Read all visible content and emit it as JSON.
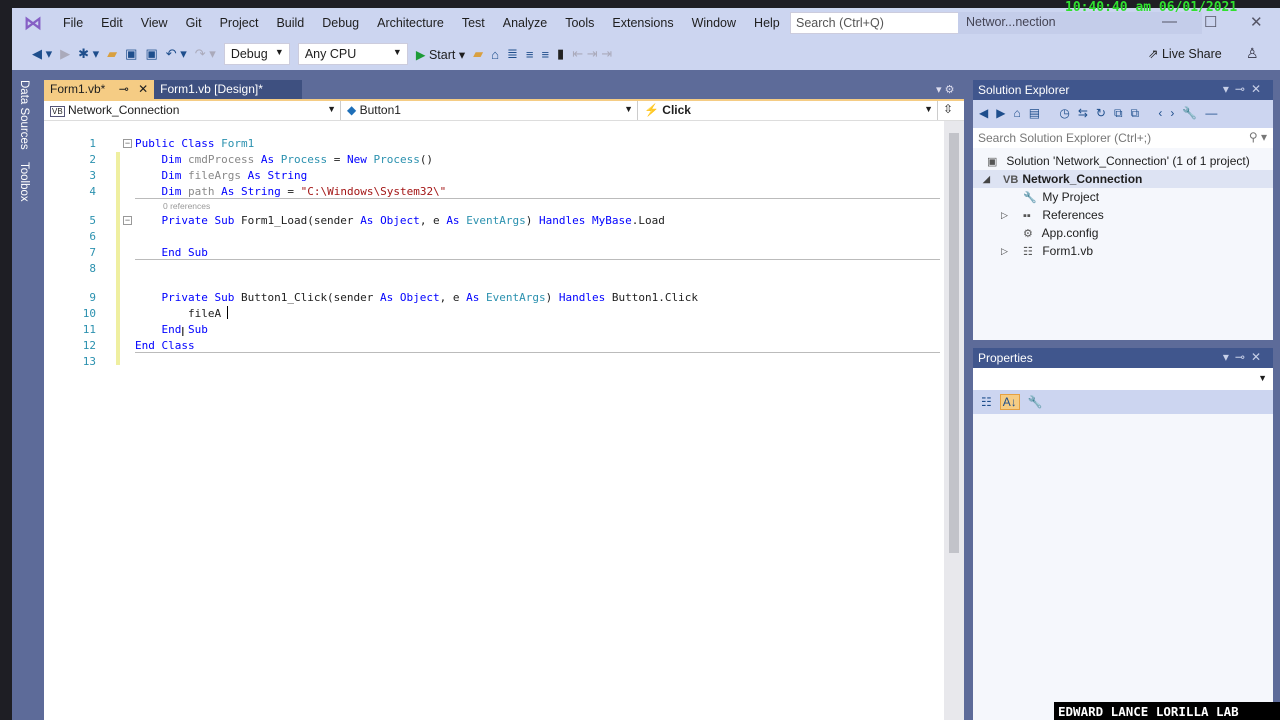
{
  "clock": "10:40:40 am 06/01/2021",
  "menu": [
    "File",
    "Edit",
    "View",
    "Git",
    "Project",
    "Build",
    "Debug",
    "Architecture",
    "Test",
    "Analyze",
    "Tools",
    "Extensions",
    "Window",
    "Help"
  ],
  "search_placeholder": "Search (Ctrl+Q)",
  "project_badge": "Networ...nection",
  "toolbar": {
    "config": "Debug",
    "platform": "Any CPU",
    "start": "Start",
    "live_share": "Live Share"
  },
  "side_tabs": [
    "Data Sources",
    "Toolbox"
  ],
  "tabs": [
    {
      "label": "Form1.vb*",
      "active": true
    },
    {
      "label": "Form1.vb [Design]*",
      "active": false
    }
  ],
  "nav": {
    "project": "Network_Connection",
    "object": "Button1",
    "event": "Click"
  },
  "code": {
    "refs_label": "0 references",
    "lines": [
      {
        "n": "1",
        "t": [
          [
            "Public Class ",
            "kw"
          ],
          [
            "Form1",
            "ty"
          ]
        ]
      },
      {
        "n": "2",
        "t": [
          [
            "    Dim ",
            "kw"
          ],
          [
            "cmdProcess ",
            "gr"
          ],
          [
            "As ",
            "kw"
          ],
          [
            "Process",
            "ty"
          ],
          [
            " = ",
            "id"
          ],
          [
            "New ",
            "kw"
          ],
          [
            "Process",
            "ty"
          ],
          [
            "()",
            "id"
          ]
        ]
      },
      {
        "n": "3",
        "t": [
          [
            "    Dim ",
            "kw"
          ],
          [
            "fileArgs ",
            "gr"
          ],
          [
            "As ",
            "kw"
          ],
          [
            "String",
            "kw"
          ]
        ]
      },
      {
        "n": "4",
        "t": [
          [
            "    Dim ",
            "kw"
          ],
          [
            "path ",
            "gr"
          ],
          [
            "As ",
            "kw"
          ],
          [
            "String",
            "kw"
          ],
          [
            " = ",
            "id"
          ],
          [
            "\"C:\\Windows\\System32\\\"",
            "st"
          ]
        ]
      },
      {
        "n": "5",
        "t": [
          [
            "    Private Sub ",
            "kw"
          ],
          [
            "Form1_Load(sender ",
            "id"
          ],
          [
            "As ",
            "kw"
          ],
          [
            "Object",
            "kw"
          ],
          [
            ", e ",
            "id"
          ],
          [
            "As ",
            "kw"
          ],
          [
            "EventArgs",
            "ty"
          ],
          [
            ") ",
            "id"
          ],
          [
            "Handles ",
            "kw"
          ],
          [
            "MyBase",
            "kw"
          ],
          [
            ".Load",
            "id"
          ]
        ]
      },
      {
        "n": "6",
        "t": []
      },
      {
        "n": "7",
        "t": [
          [
            "    End Sub",
            "kw"
          ]
        ]
      },
      {
        "n": "8",
        "t": []
      },
      {
        "n": "9",
        "t": [
          [
            "    Private Sub ",
            "kw"
          ],
          [
            "Button1_Click(sender ",
            "id"
          ],
          [
            "As ",
            "kw"
          ],
          [
            "Object",
            "kw"
          ],
          [
            ", e ",
            "id"
          ],
          [
            "As ",
            "kw"
          ],
          [
            "EventArgs",
            "ty"
          ],
          [
            ") ",
            "id"
          ],
          [
            "Handles ",
            "kw"
          ],
          [
            "Button1.Click",
            "id"
          ]
        ]
      },
      {
        "n": "10",
        "t": [
          [
            "        fileA",
            "id"
          ]
        ]
      },
      {
        "n": "11",
        "t": [
          [
            "    End Sub",
            "kw"
          ]
        ]
      },
      {
        "n": "12",
        "t": [
          [
            "End Class",
            "kw"
          ]
        ]
      },
      {
        "n": "13",
        "t": []
      }
    ]
  },
  "solution_explorer": {
    "title": "Solution Explorer",
    "search_placeholder": "Search Solution Explorer (Ctrl+;)",
    "items": [
      {
        "label": "Solution 'Network_Connection' (1 of 1 project)",
        "icon": "solution-icon"
      },
      {
        "label": "Network_Connection",
        "icon": "vb-project-icon"
      },
      {
        "label": "My Project",
        "icon": "wrench-icon"
      },
      {
        "label": "References",
        "icon": "references-icon"
      },
      {
        "label": "App.config",
        "icon": "config-file-icon"
      },
      {
        "label": "Form1.vb",
        "icon": "form-icon"
      }
    ]
  },
  "properties": {
    "title": "Properties"
  },
  "watermark": "EDWARD LANCE LORILLA LAB"
}
